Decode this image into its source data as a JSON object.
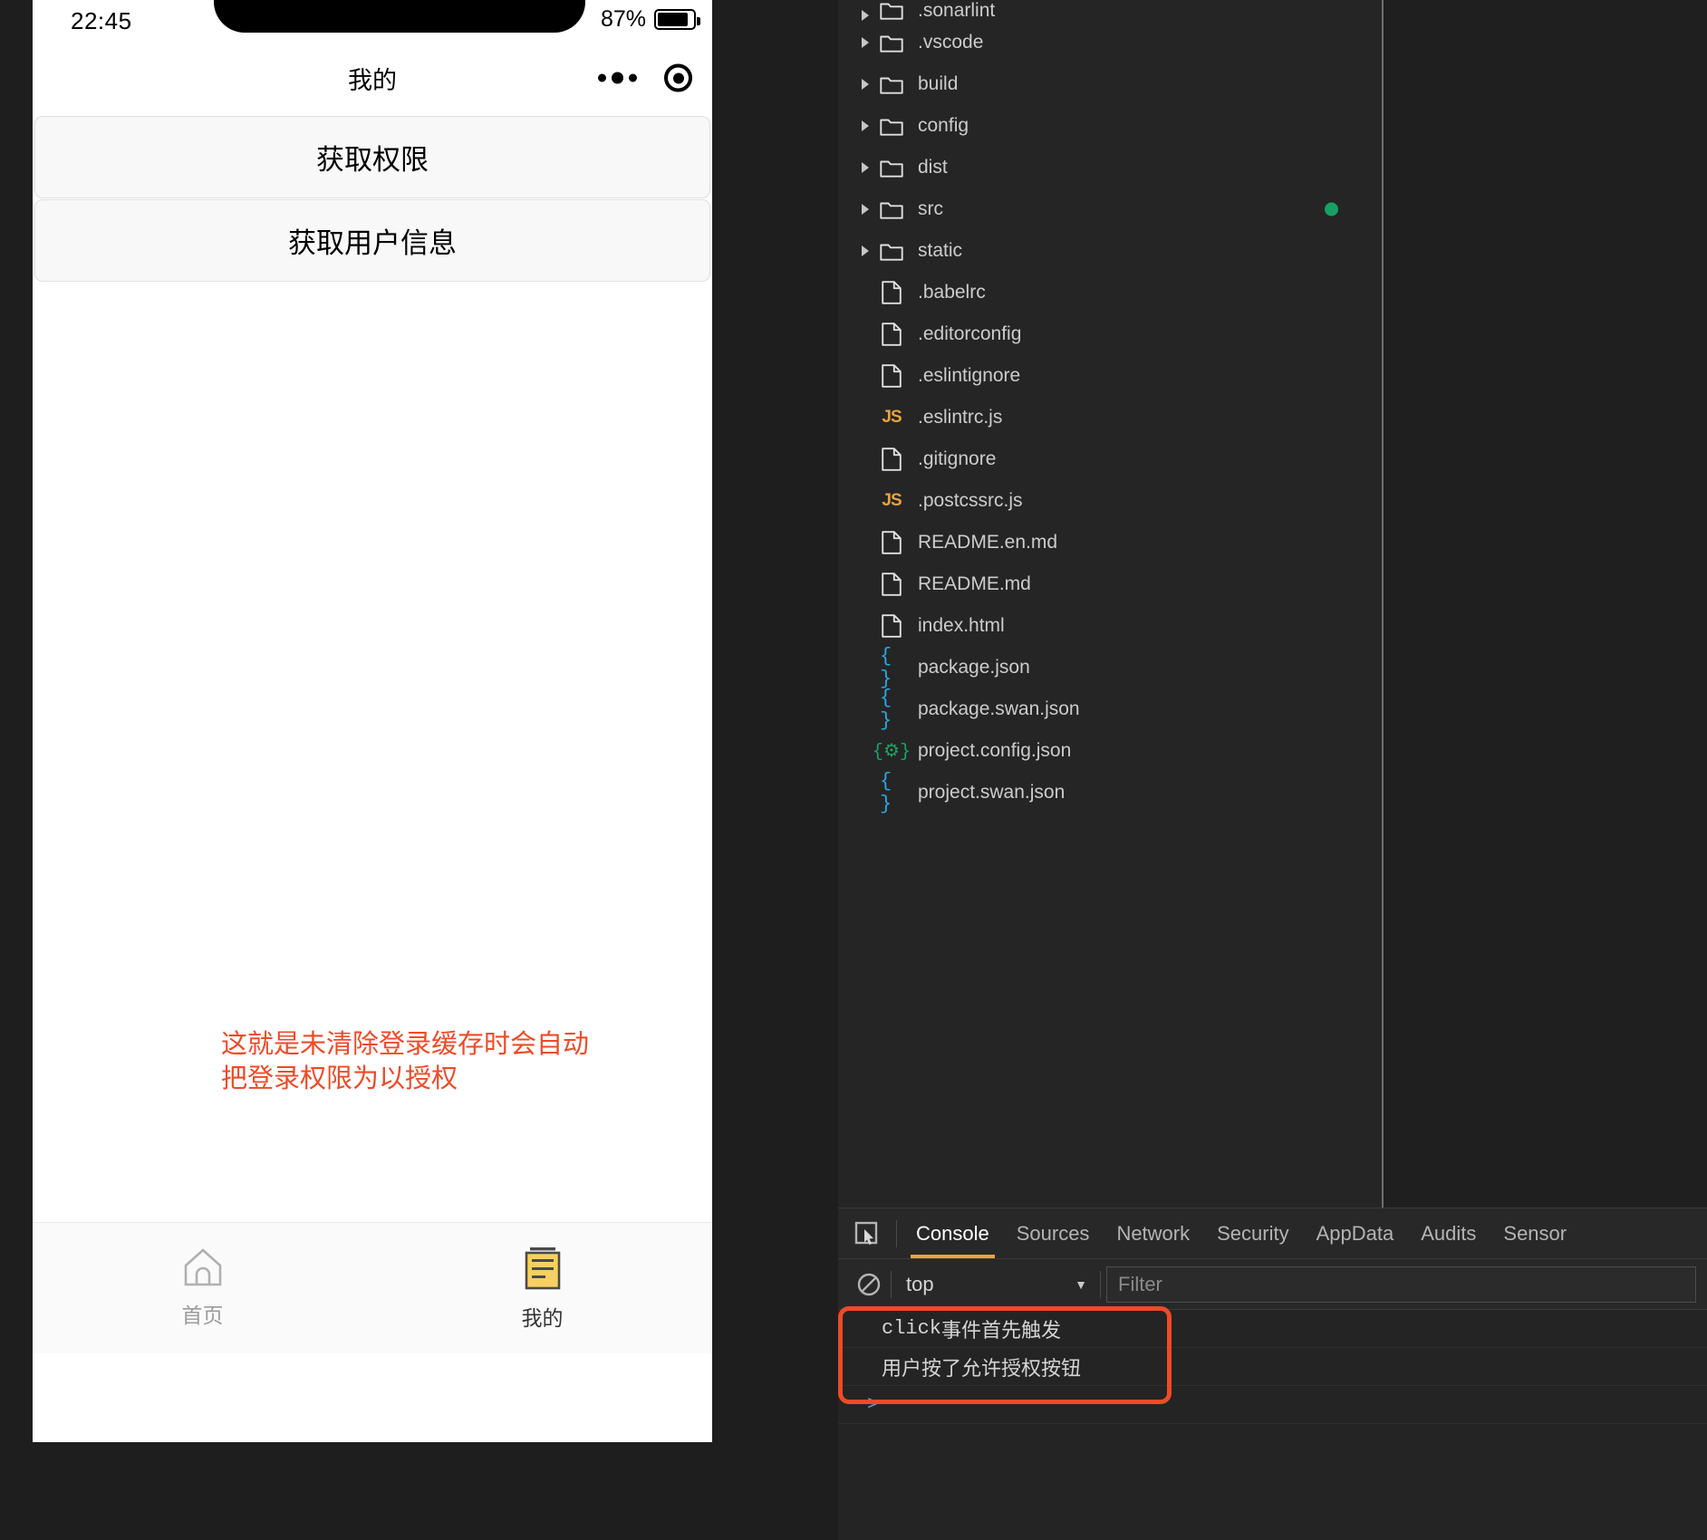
{
  "simulator": {
    "status_bar": {
      "time": "22:45",
      "battery_percent": "87%",
      "battery_level": 87
    },
    "navbar": {
      "title": "我的",
      "more_icon": "more-dots-icon",
      "capsule_icon": "target-circle-icon"
    },
    "buttons": [
      {
        "label": "获取权限"
      },
      {
        "label": "获取用户信息"
      }
    ],
    "annotation": "这就是未清除登录缓存时会自动\n把登录权限为以授权",
    "annotation_color": "#ef4a28",
    "tabbar": [
      {
        "label": "首页",
        "icon": "home-icon",
        "active": false
      },
      {
        "label": "我的",
        "icon": "document-icon",
        "active": true
      }
    ]
  },
  "devtools": {
    "file_tree": [
      {
        "name": ".sonarlint",
        "type": "folder",
        "expandable": true,
        "clipped": true,
        "marker": false
      },
      {
        "name": ".vscode",
        "type": "folder",
        "expandable": true,
        "marker": false
      },
      {
        "name": "build",
        "type": "folder",
        "expandable": true,
        "marker": false
      },
      {
        "name": "config",
        "type": "folder",
        "expandable": true,
        "marker": false
      },
      {
        "name": "dist",
        "type": "folder",
        "expandable": true,
        "marker": false
      },
      {
        "name": "src",
        "type": "folder",
        "expandable": true,
        "marker": true
      },
      {
        "name": "static",
        "type": "folder",
        "expandable": true,
        "marker": false
      },
      {
        "name": ".babelrc",
        "type": "file",
        "expandable": false,
        "marker": false
      },
      {
        "name": ".editorconfig",
        "type": "file",
        "expandable": false,
        "marker": false
      },
      {
        "name": ".eslintignore",
        "type": "file",
        "expandable": false,
        "marker": false
      },
      {
        "name": ".eslintrc.js",
        "type": "js",
        "expandable": false,
        "marker": false
      },
      {
        "name": ".gitignore",
        "type": "file",
        "expandable": false,
        "marker": false
      },
      {
        "name": ".postcssrc.js",
        "type": "js",
        "expandable": false,
        "marker": false
      },
      {
        "name": "README.en.md",
        "type": "file",
        "expandable": false,
        "marker": false
      },
      {
        "name": "README.md",
        "type": "file",
        "expandable": false,
        "marker": false
      },
      {
        "name": "index.html",
        "type": "file",
        "expandable": false,
        "marker": false
      },
      {
        "name": "package.json",
        "type": "json",
        "expandable": false,
        "marker": false
      },
      {
        "name": "package.swan.json",
        "type": "json",
        "expandable": false,
        "marker": false
      },
      {
        "name": "project.config.json",
        "type": "jsoncfg",
        "expandable": false,
        "marker": false
      },
      {
        "name": "project.swan.json",
        "type": "json",
        "expandable": false,
        "marker": false
      }
    ],
    "marker_color": "#16a163",
    "drawer": {
      "inspect_icon": "inspect-element-icon",
      "tabs": [
        {
          "label": "Console",
          "active": true
        },
        {
          "label": "Sources",
          "active": false
        },
        {
          "label": "Network",
          "active": false
        },
        {
          "label": "Security",
          "active": false
        },
        {
          "label": "AppData",
          "active": false
        },
        {
          "label": "Audits",
          "active": false
        },
        {
          "label": "Sensor",
          "active": false
        }
      ],
      "active_tab_underline_color": "#e8a33d",
      "toolbar": {
        "clear_icon": "clear-console-icon",
        "context": "top",
        "context_caret": "▼",
        "filter_placeholder": "Filter",
        "filter_value": ""
      },
      "console_messages": [
        {
          "text": "click事件首先触发",
          "mono_prefix": "click",
          "cjk_rest": "事件首先触发"
        },
        {
          "text": "用户按了允许授权按钮",
          "mono_prefix": "",
          "cjk_rest": "用户按了允许授权按钮"
        }
      ],
      "prompt": ">",
      "highlight_color": "#ef4a28"
    }
  }
}
